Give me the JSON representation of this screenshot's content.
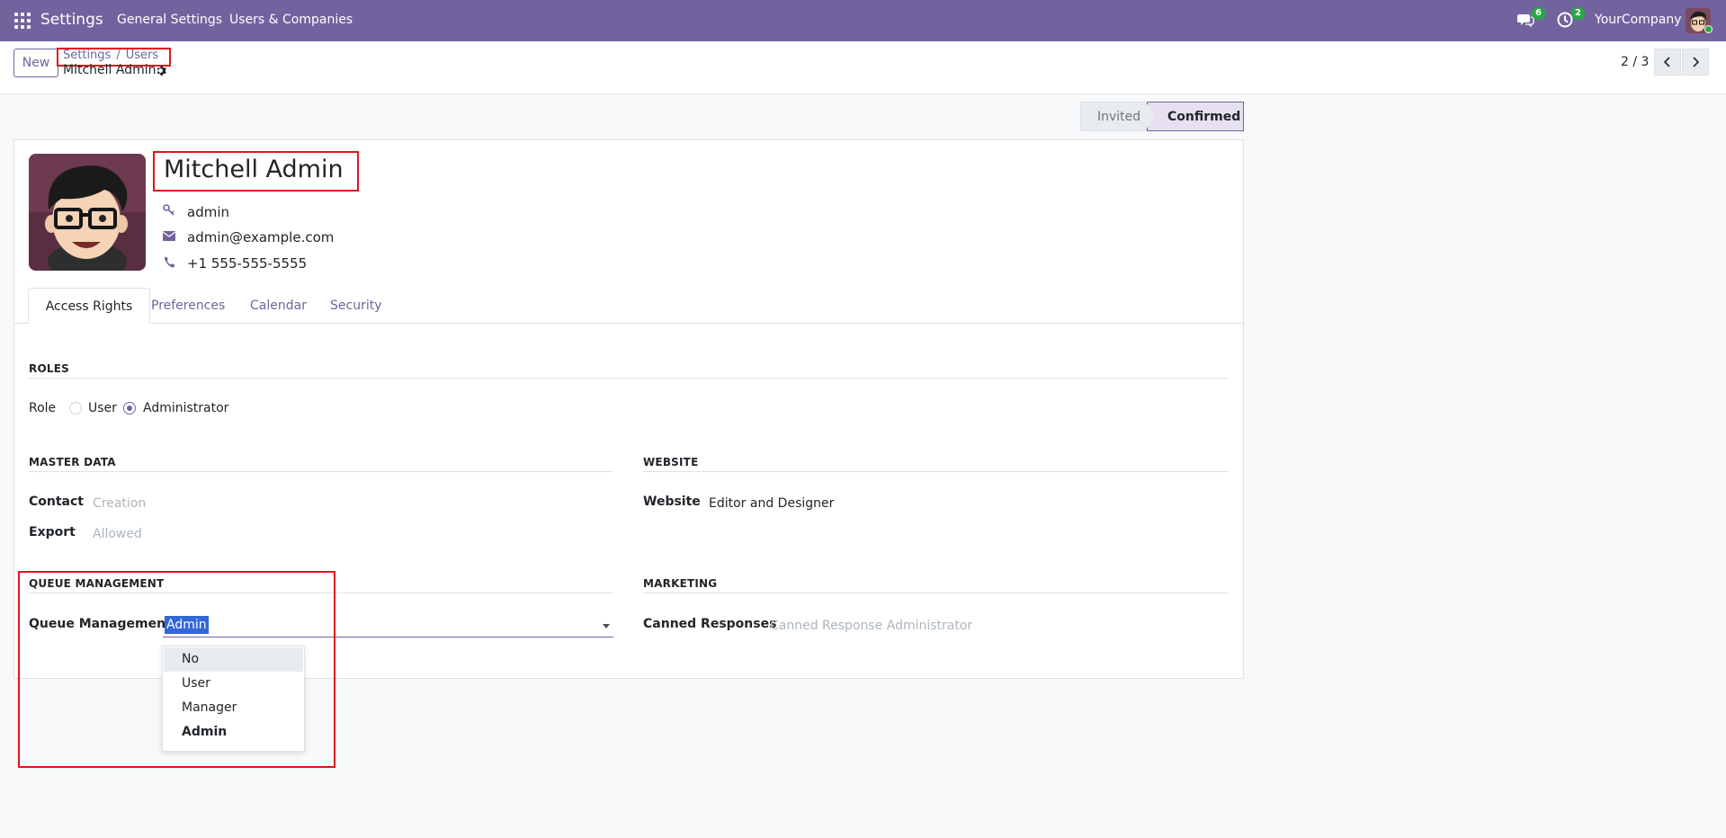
{
  "navbar": {
    "brand": "Settings",
    "links": [
      "General Settings",
      "Users & Companies"
    ],
    "chat_badge": "6",
    "activity_badge": "2",
    "company": "YourCompany"
  },
  "control": {
    "new_label": "New",
    "breadcrumb": [
      "Settings",
      "Users"
    ],
    "breadcrumb_sep": "/",
    "record_title": "Mitchell Admin",
    "pager": "2 / 3"
  },
  "status": {
    "invited": "Invited",
    "confirmed": "Confirmed"
  },
  "user": {
    "name": "Mitchell Admin",
    "login": "admin",
    "email": "admin@example.com",
    "phone": "+1 555-555-5555"
  },
  "tabs": [
    "Access Rights",
    "Preferences",
    "Calendar",
    "Security"
  ],
  "roles": {
    "title": "ROLES",
    "label": "Role",
    "options": [
      "User",
      "Administrator"
    ],
    "selected": "Administrator"
  },
  "master_data": {
    "title": "MASTER DATA",
    "contact_label": "Contact",
    "contact_value": "Creation",
    "export_label": "Export",
    "export_value": "Allowed"
  },
  "website": {
    "title": "WEBSITE",
    "label": "Website",
    "value": "Editor and Designer"
  },
  "queue": {
    "title": "QUEUE MANAGEMENT",
    "label": "Queue Management",
    "value": "Admin",
    "options": [
      "No",
      "User",
      "Manager",
      "Admin"
    ]
  },
  "marketing": {
    "title": "MARKETING",
    "label": "Canned Responses",
    "value": "Canned Response Administrator"
  },
  "colors": {
    "brand": "#71639e",
    "highlight": "#e0141e",
    "selection": "#3367d6",
    "badge": "#28a745"
  }
}
